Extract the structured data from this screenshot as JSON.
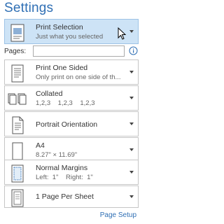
{
  "settings": {
    "title": "Settings"
  },
  "print_what": {
    "label": "Print Selection",
    "sub": "Just what you selected",
    "icon": "print-selection-icon"
  },
  "pages": {
    "label": "Pages:",
    "value": "",
    "placeholder": ""
  },
  "sides": {
    "label": "Print One Sided",
    "sub": "Only print on one side of th...",
    "icon": "one-sided-icon"
  },
  "collation": {
    "label": "Collated",
    "sub": "1,2,3    1,2,3    1,2,3",
    "icon": "collated-icon"
  },
  "orientation": {
    "label": "Portrait Orientation",
    "icon": "portrait-icon"
  },
  "paper": {
    "label": "A4",
    "sub": "8.27\" × 11.69\"",
    "icon": "paper-size-icon"
  },
  "margins": {
    "label": "Normal Margins",
    "sub": "Left:  1\"    Right:  1\"",
    "icon": "margins-icon"
  },
  "per_sheet": {
    "label": "1 Page Per Sheet",
    "icon": "pages-per-sheet-icon"
  },
  "page_setup": {
    "label": "Page Setup"
  },
  "colors": {
    "accent": "#2f6fb4",
    "selected_bg": "#cde3f6",
    "border": "#c6c6c6"
  }
}
